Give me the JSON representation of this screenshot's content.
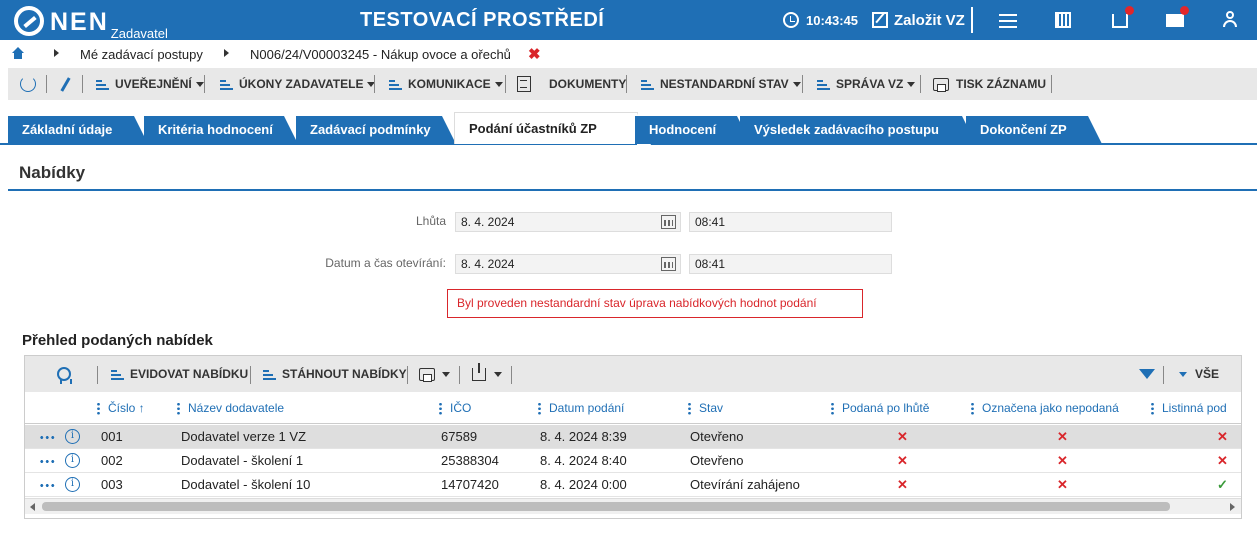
{
  "header": {
    "logo_text": "NEN",
    "logo_sub": "Zadavatel",
    "env_title": "TESTOVACÍ PROSTŘEDÍ",
    "clock": "10:43:45",
    "create_label": "Založit VZ",
    "icons": [
      "menu-icon",
      "calculator-icon",
      "inbox-icon",
      "mail-icon",
      "user-icon"
    ]
  },
  "breadcrumb": {
    "items": [
      "Mé zadávací postupy",
      "N006/24/V00003245 - Nákup ovoce a ořechů"
    ],
    "close_symbol": "✖"
  },
  "toolbar": {
    "items": [
      "UVEŘEJNĚNÍ",
      "ÚKONY ZADAVATELE",
      "KOMUNIKACE",
      "DOKUMENTY",
      "NESTANDARDNÍ STAV",
      "SPRÁVA VZ",
      "TISK ZÁZNAMU"
    ]
  },
  "tabs": [
    {
      "label": "Základní údaje"
    },
    {
      "label": "Kritéria hodnocení"
    },
    {
      "label": "Zadávací podmínky"
    },
    {
      "label": "Podání účastníků ZP",
      "active": true
    },
    {
      "label": "Hodnocení"
    },
    {
      "label": "Výsledek zadávacího postupu"
    },
    {
      "label": "Dokončení ZP"
    }
  ],
  "section": {
    "title": "Nabídky",
    "deadline_label": "Lhůta",
    "deadline_date": "8. 4. 2024",
    "deadline_time": "08:41",
    "opening_label": "Datum a čas otevírání:",
    "opening_date": "8. 4. 2024",
    "opening_time": "08:41",
    "alert": "Byl proveden nestandardní stav úprava nabídkových hodnot podání"
  },
  "grid": {
    "title": "Přehled podaných nabídek",
    "toolbar": {
      "register_label": "EVIDOVAT NABÍDKU",
      "download_label": "STÁHNOUT NABÍDKY",
      "filter_all_label": "VŠE"
    },
    "columns": [
      "Číslo ↑",
      "Název dodavatele",
      "IČO",
      "Datum podání",
      "Stav",
      "Podaná po lhůtě",
      "Označena jako nepodaná",
      "Listinná pod"
    ],
    "rows": [
      {
        "cislo": "001",
        "nazev": "Dodavatel verze 1 VZ",
        "ico": "67589",
        "datum": "8. 4. 2024 8:39",
        "stav": "Otevřeno",
        "po_lhute": "✕",
        "nepodana": "✕",
        "listinna": "✕"
      },
      {
        "cislo": "002",
        "nazev": "Dodavatel - školení 1",
        "ico": "25388304",
        "datum": "8. 4. 2024 8:40",
        "stav": "Otevřeno",
        "po_lhute": "✕",
        "nepodana": "✕",
        "listinna": "✕"
      },
      {
        "cislo": "003",
        "nazev": "Dodavatel - školení 10",
        "ico": "14707420",
        "datum": "8. 4. 2024 0:00",
        "stav": "Otevírání zahájeno",
        "po_lhute": "✕",
        "nepodana": "✕",
        "listinna": "✓"
      }
    ],
    "info_symbol": "i"
  },
  "colors": {
    "brand_blue": "#1f6fb5",
    "error_red": "#d9262b",
    "success_green": "#3a9a3a"
  }
}
